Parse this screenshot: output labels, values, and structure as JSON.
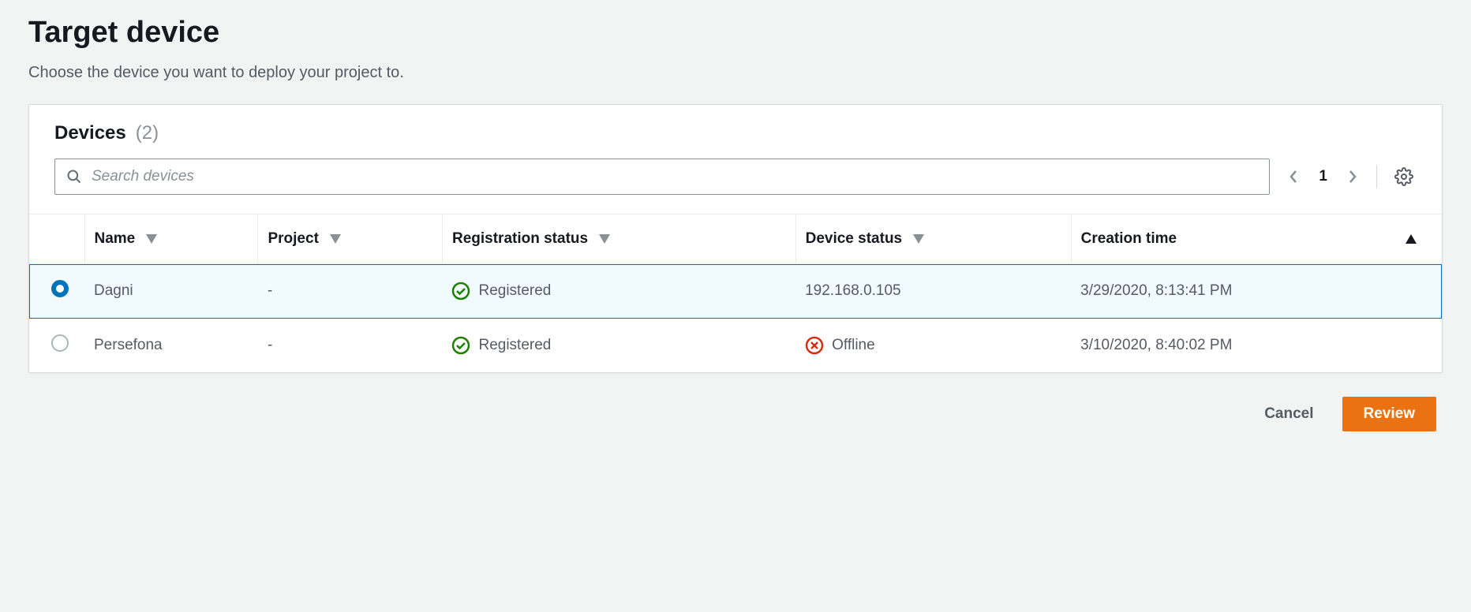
{
  "header": {
    "title": "Target device",
    "subtitle": "Choose the device you want to deploy your project to."
  },
  "panel": {
    "title": "Devices",
    "count": "(2)",
    "search_placeholder": "Search devices",
    "page_number": "1"
  },
  "columns": {
    "name": "Name",
    "project": "Project",
    "registration_status": "Registration status",
    "device_status": "Device status",
    "creation_time": "Creation time"
  },
  "rows": [
    {
      "selected": true,
      "name": "Dagni",
      "project": "-",
      "registration_status": "Registered",
      "registration_icon": "success",
      "device_status": "192.168.0.105",
      "device_status_icon": "none",
      "creation_time": "3/29/2020, 8:13:41 PM"
    },
    {
      "selected": false,
      "name": "Persefona",
      "project": "-",
      "registration_status": "Registered",
      "registration_icon": "success",
      "device_status": "Offline",
      "device_status_icon": "error",
      "creation_time": "3/10/2020, 8:40:02 PM"
    }
  ],
  "footer": {
    "cancel": "Cancel",
    "review": "Review"
  }
}
